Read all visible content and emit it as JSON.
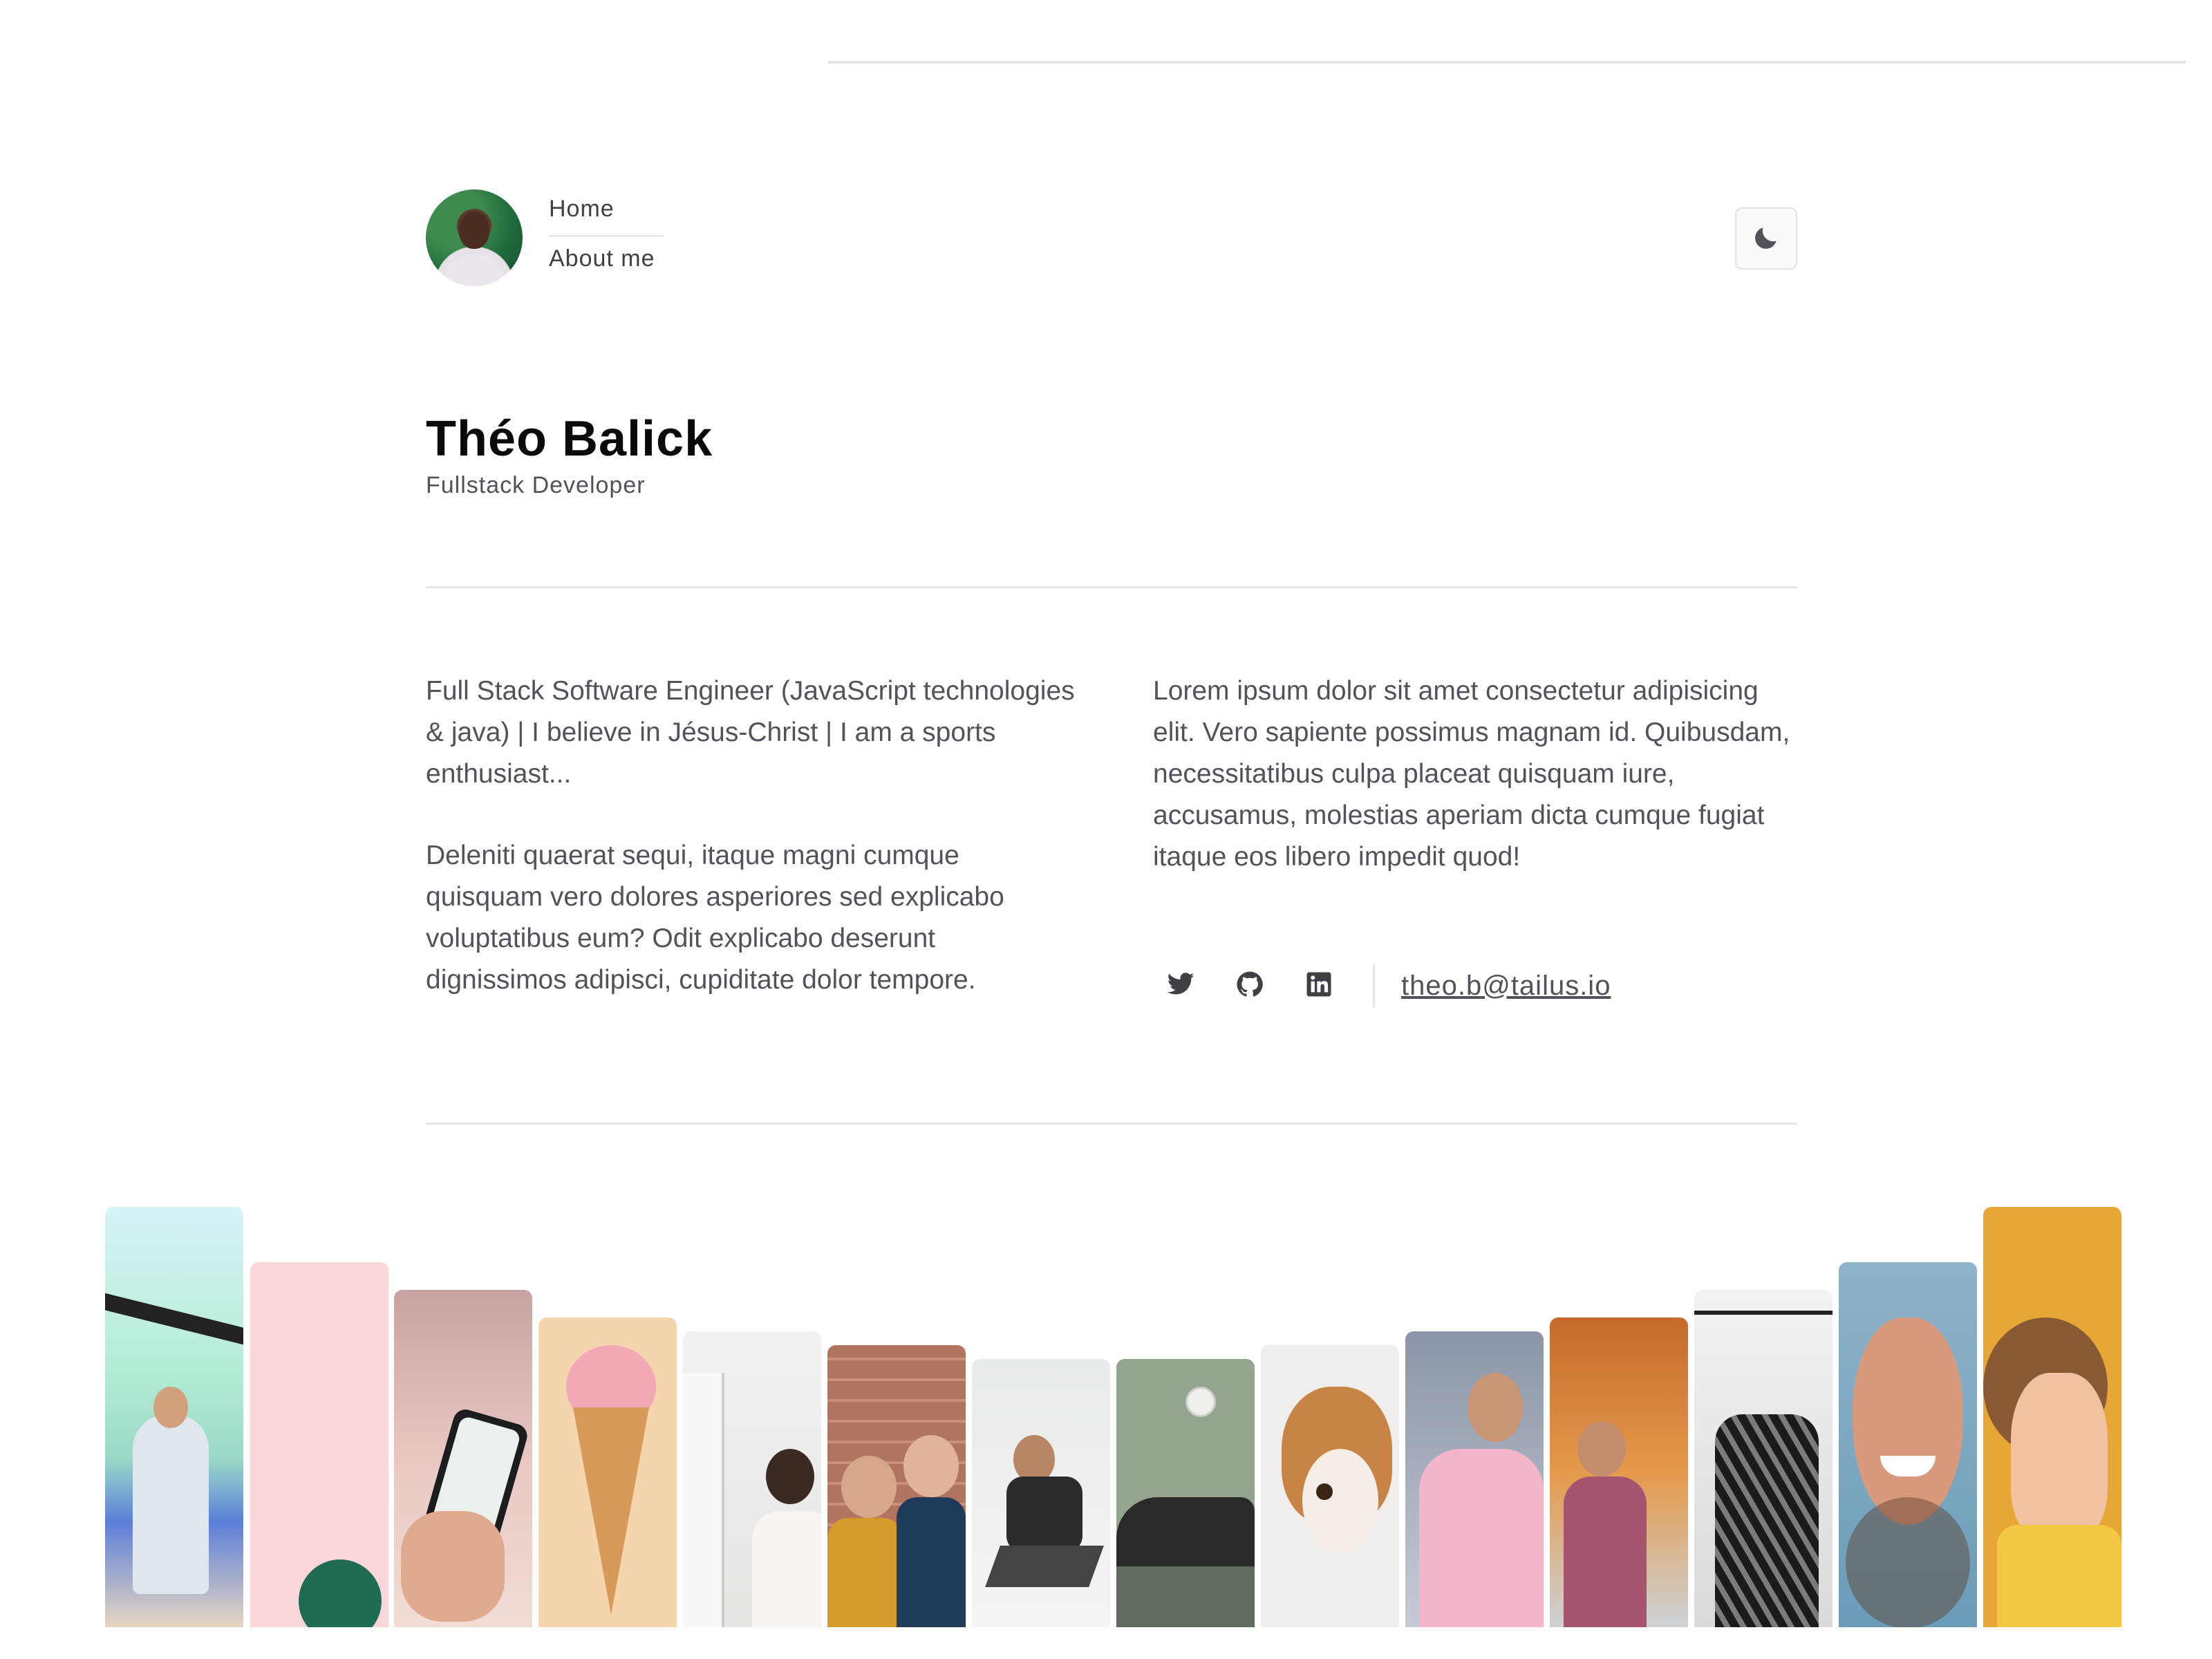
{
  "header": {
    "nav": [
      "Home",
      "About me"
    ]
  },
  "profile": {
    "name": "Théo Balick",
    "role": "Fullstack Developer"
  },
  "bio": {
    "paragraph_1": "Full Stack Software Engineer (JavaScript technologies & java) | I believe in Jésus-Christ | I am a sports enthusiast...",
    "paragraph_2": "Deleniti quaerat sequi, itaque magni cumque quisquam vero dolores asperiores sed explicabo voluptatibus eum? Odit explicabo deserunt dignissimos adipisci, cupiditate dolor tempore."
  },
  "about": {
    "paragraph": "Lorem ipsum dolor sit amet consectetur adipisicing elit. Vero sapiente possimus magnam id. Quibusdam, necessitatibus culpa placeat quisquam iure, accusamus, molestias aperiam dicta cumque fugiat itaque eos libero impedit quod!"
  },
  "socials": {
    "icons": [
      "twitter-icon",
      "github-icon",
      "linkedin-icon"
    ],
    "email": "theo.b@tailus.io"
  },
  "colors": {
    "text_dark": "#0a0a0a",
    "text_body": "#52525b",
    "rule": "#e4e4e7"
  }
}
